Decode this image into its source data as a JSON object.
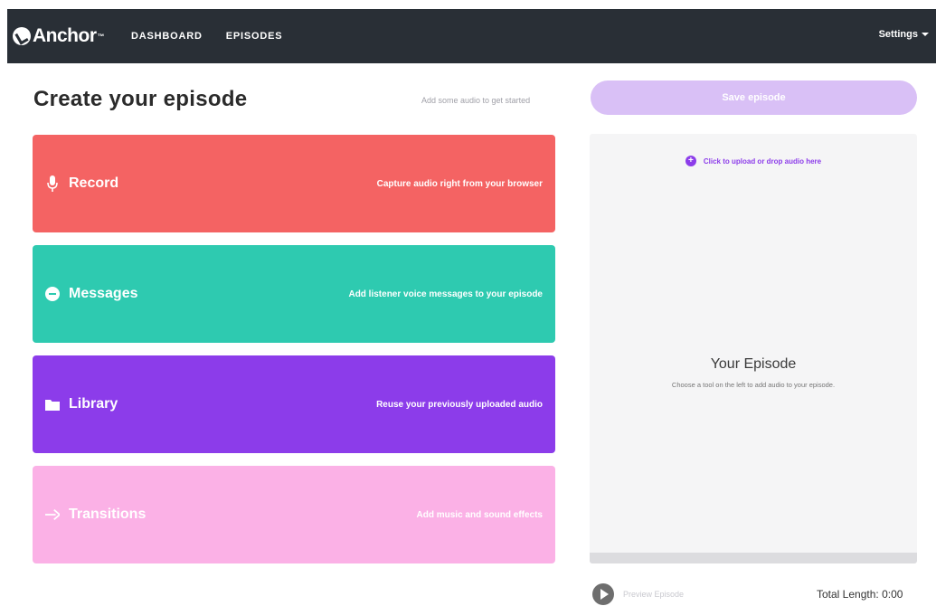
{
  "nav": {
    "brand": "Anchor",
    "links": [
      "DASHBOARD",
      "EPISODES"
    ],
    "settings_label": "Settings"
  },
  "create": {
    "title": "Create your episode",
    "hint": "Add some audio to get started"
  },
  "tools": [
    {
      "name": "Record",
      "description": "Capture audio right from your browser",
      "icon": "microphone-icon",
      "color": "#f46363"
    },
    {
      "name": "Messages",
      "description": "Add listener voice messages to your episode",
      "icon": "message-bubble-icon",
      "color": "#2ecab0"
    },
    {
      "name": "Library",
      "description": "Reuse your previously uploaded audio",
      "icon": "folder-icon",
      "color": "#8c3cea"
    },
    {
      "name": "Transitions",
      "description": "Add music and sound effects",
      "icon": "arrow-right-icon",
      "color": "#fbb1e6"
    }
  ],
  "episode": {
    "save_label": "Save episode",
    "upload_label": "Click to upload or drop audio here",
    "heading": "Your Episode",
    "subtext": "Choose a tool on the left to add audio to your episode.",
    "preview_label": "Preview Episode",
    "total_length_label": "Total Length:",
    "total_length_value": "0:00"
  },
  "colors": {
    "nav_bg": "#292f36",
    "accent": "#8c3cea",
    "save_button": "#d9c0f6"
  }
}
